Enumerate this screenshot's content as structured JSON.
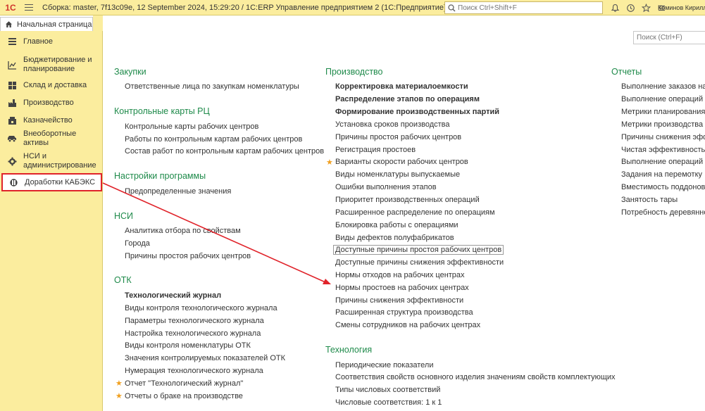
{
  "topbar": {
    "logo": "1С",
    "title": "Сборка: master, 7f13c09e, 12 September 2024, 15:29:20 / 1C:ERP Управление предприятием 2  (1С:Предприятие)",
    "search_placeholder": "Поиск Ctrl+Shift+F",
    "user": "Коминов Кирилл А"
  },
  "tab": {
    "home_label": "Начальная страница"
  },
  "sidebar": {
    "items": [
      {
        "label": "Главное",
        "icon": "list-icon"
      },
      {
        "label": "Бюджетирование и планирование",
        "icon": "chart-icon"
      },
      {
        "label": "Склад и доставка",
        "icon": "warehouse-icon"
      },
      {
        "label": "Производство",
        "icon": "factory-icon"
      },
      {
        "label": "Казначейство",
        "icon": "treasury-icon"
      },
      {
        "label": "Внеоборотные активы",
        "icon": "car-icon"
      },
      {
        "label": "НСИ и администрирование",
        "icon": "gear-icon"
      },
      {
        "label": "Доработки КАБЭКС",
        "icon": "modules-icon"
      }
    ]
  },
  "main": {
    "search_placeholder": "Поиск (Ctrl+F)",
    "col1": {
      "sections": [
        {
          "title": "Закупки",
          "links": [
            "Ответственные лица по закупкам номенклатуры"
          ]
        },
        {
          "title": "Контрольные карты РЦ",
          "links": [
            "Контрольные карты рабочих центров",
            "Работы по контрольным картам рабочих центров",
            "Состав работ по контрольным картам рабочих центров"
          ]
        },
        {
          "title": "Настройки программы",
          "links": [
            "Предопределенные значения"
          ]
        },
        {
          "title": "НСИ",
          "links": [
            "Аналитика отбора по свойствам",
            "Города",
            "Причины простоя рабочих центров"
          ]
        },
        {
          "title": "ОТК",
          "links": [
            "Технологический журнал",
            "Виды контроля технологического журнала",
            "Параметры технологического журнала",
            "Настройка технологического журнала",
            "Виды контроля номенклатуры ОТК",
            "Значения контролируемых показателей ОТК",
            "Нумерация технологического журнала",
            "Отчет \"Технологический журнал\"",
            "Отчеты о браке на производстве"
          ]
        }
      ]
    },
    "col2": {
      "sections": [
        {
          "title": "Производство",
          "links": [
            "Корректировка материалоемкости",
            "Распределение этапов по операциям",
            "Формирование производственных партий",
            "Установка сроков производства",
            "Причины простоя рабочих центров",
            "Регистрация простоев",
            "Варианты скорости рабочих центров",
            "Виды номенклатуры выпускаемые",
            "Ошибки выполнения этапов",
            "Приоритет производственных операций",
            "Расширенное распределение по операциям",
            "Блокировка работы с операциями",
            "Виды дефектов полуфабрикатов",
            "Доступные причины простоя рабочих центров",
            "Доступные причины снижения эффективности",
            "Нормы отходов на рабочих центрах",
            "Нормы простоев на рабочих центрах",
            "Причины снижения эффективности",
            "Расширенная структура производства",
            "Смены сотрудников на рабочих центрах"
          ]
        },
        {
          "title": "Технология",
          "links": [
            "Периодические показатели",
            "Соответствия свойств основного изделия значениям свойств комплектующих",
            "Типы числовых соответствий",
            "Числовые соответствия: 1 к 1"
          ]
        }
      ]
    },
    "col3": {
      "sections": [
        {
          "title": "Отчеты",
          "links": [
            "Выполнение заказов на р",
            "Выполнение операций пл",
            "Метрики планирования оп",
            "Метрики производства пл",
            "Причины снижения эффе",
            "Чистая эффективность вь",
            "Выполнение операций пе",
            "Задания на перемотку",
            "Вместимость поддонов п",
            "Занятость тары",
            "Потребность деревянной"
          ]
        }
      ]
    }
  }
}
